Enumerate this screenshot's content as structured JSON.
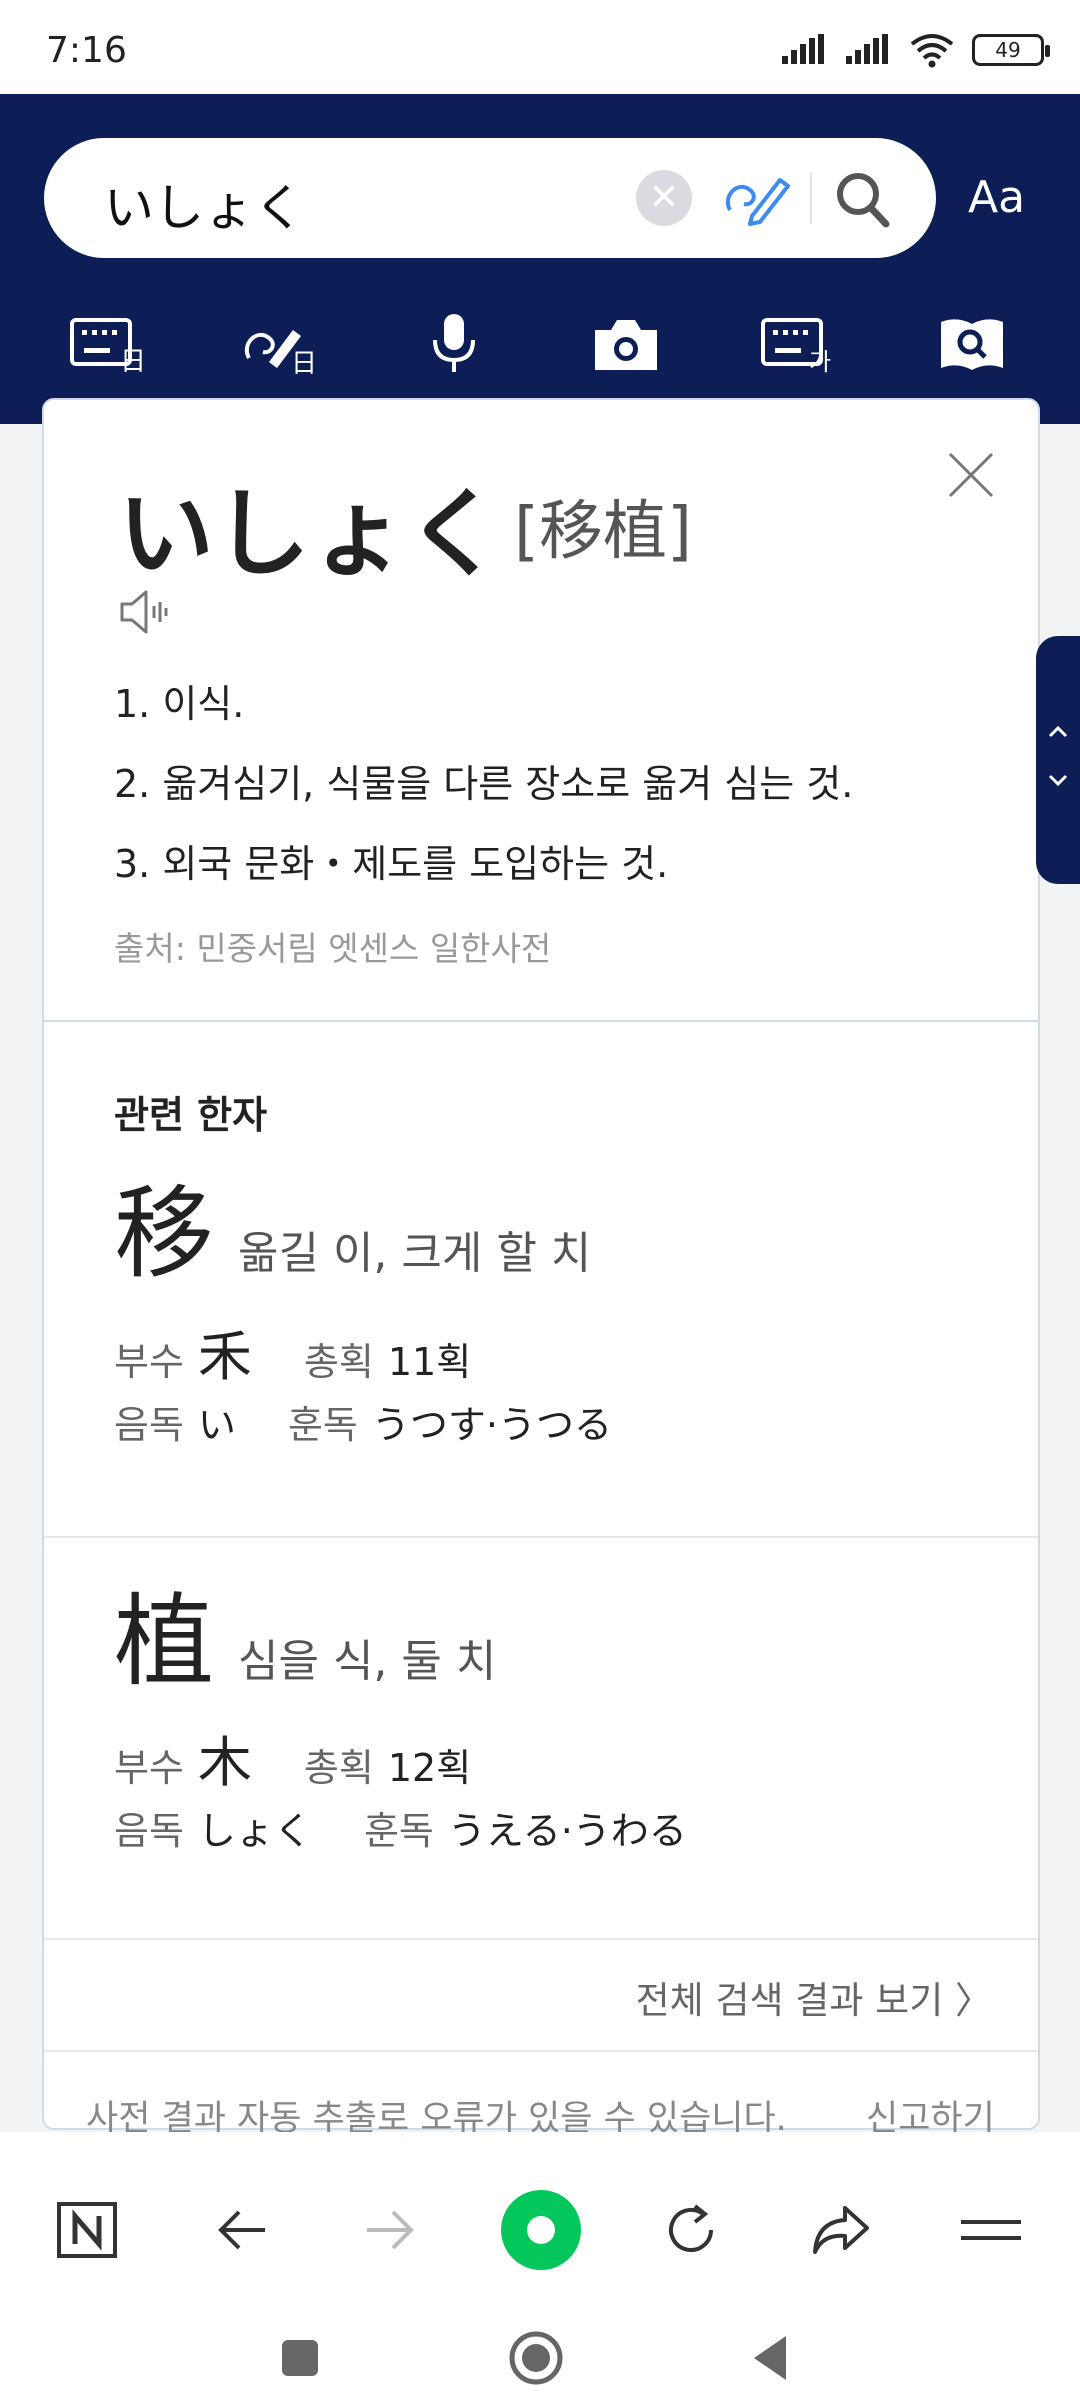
{
  "status_bar": {
    "time": "7:16",
    "battery": "49"
  },
  "search": {
    "query": "いしょく",
    "font_label": "Aa"
  },
  "entry": {
    "headword": "いしょく",
    "hanja": "[移植]",
    "meanings": [
      "1. 이식.",
      "2. 옮겨심기, 식물을 다른 장소로 옮겨 심는 것.",
      "3. 외국 문화・제도를 도입하는 것."
    ],
    "source": "출처: 민중서림 엣센스 일한사전"
  },
  "related": {
    "title": "관련 한자",
    "items": [
      {
        "char": "移",
        "meaning": "옮길 이, 크게 할 치",
        "radical_label": "부수",
        "radical": "禾",
        "strokes_label": "총획",
        "strokes": "11획",
        "on_label": "음독",
        "on": "い",
        "kun_label": "훈독",
        "kun": "うつす·うつる"
      },
      {
        "char": "植",
        "meaning": "심을 식, 둘 치",
        "radical_label": "부수",
        "radical": "木",
        "strokes_label": "총획",
        "strokes": "12획",
        "on_label": "음독",
        "on": "しょく",
        "kun_label": "훈독",
        "kun": "うえる·うわる"
      }
    ]
  },
  "more_link": "전체 검색 결과 보기 〉",
  "notice": "사전 결과 자동 추출로 오류가 있을 수 있습니다.",
  "report": "신고하기",
  "colors": {
    "header": "#0c1e55",
    "accent": "#03c75a"
  },
  "icons": {
    "toolbar": [
      "keyboard-ja-icon",
      "handwriting-ja-icon",
      "microphone-icon",
      "camera-icon",
      "keyboard-ko-icon",
      "dictionary-search-icon"
    ],
    "nav": [
      "naver-home-icon",
      "back-icon",
      "forward-icon",
      "green-dot-icon",
      "refresh-icon",
      "share-icon",
      "menu-icon"
    ]
  }
}
